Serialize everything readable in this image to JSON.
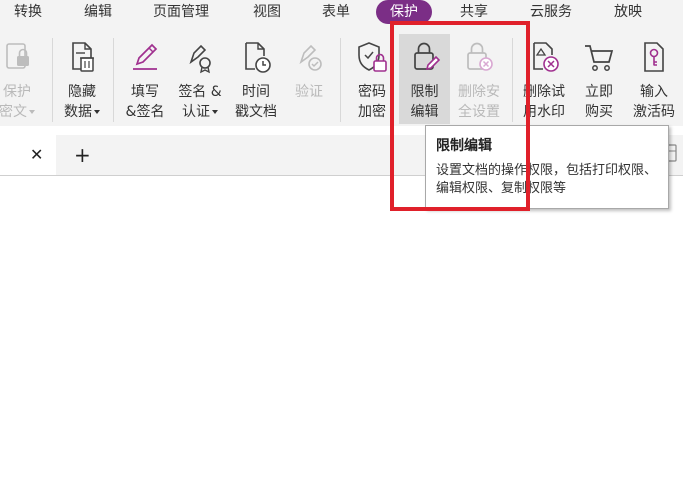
{
  "menu": {
    "tabs": [
      "转换",
      "编辑",
      "页面管理",
      "视图",
      "表单",
      "保护",
      "共享",
      "云服务",
      "放映"
    ],
    "active_index": 5,
    "active_color": "#7b2e86"
  },
  "ribbon": {
    "buttons": [
      {
        "label1": "保护",
        "label2": "密文",
        "dropdown": true,
        "enabled": false,
        "icon": "protect-doc-icon"
      },
      {
        "label1": "隐藏",
        "label2": "数据",
        "dropdown": true,
        "enabled": true,
        "icon": "hide-data-icon"
      },
      {
        "label1": "填写",
        "label2": "&签名",
        "dropdown": false,
        "enabled": true,
        "icon": "pen-sign-icon"
      },
      {
        "label1": "签名 &",
        "label2": "认证",
        "dropdown": true,
        "enabled": true,
        "icon": "sign-certify-icon"
      },
      {
        "label1": "时间",
        "label2": "戳文档",
        "dropdown": false,
        "enabled": true,
        "icon": "timestamp-icon"
      },
      {
        "label1": "验证",
        "label2": "",
        "dropdown": false,
        "enabled": false,
        "icon": "validate-icon"
      },
      {
        "label1": "密码",
        "label2": "加密",
        "dropdown": false,
        "enabled": true,
        "icon": "password-encrypt-icon"
      },
      {
        "label1": "限制",
        "label2": "编辑",
        "dropdown": false,
        "enabled": true,
        "icon": "restrict-edit-icon"
      },
      {
        "label1": "删除安",
        "label2": "全设置",
        "dropdown": false,
        "enabled": false,
        "icon": "remove-security-icon"
      },
      {
        "label1": "删除试",
        "label2": "用水印",
        "dropdown": false,
        "enabled": true,
        "icon": "remove-watermark-icon"
      },
      {
        "label1": "立即",
        "label2": "购买",
        "dropdown": false,
        "enabled": true,
        "icon": "cart-icon"
      },
      {
        "label1": "输入",
        "label2": "激活码",
        "dropdown": false,
        "enabled": true,
        "icon": "activation-key-icon"
      }
    ]
  },
  "tabs": {
    "close_glyph": "✕",
    "add_glyph": "+"
  },
  "tooltip": {
    "title": "限制编辑",
    "description": "设置文档的操作权限，包括打印权限、编辑权限、复制权限等"
  },
  "colors": {
    "highlight": "#e0202a",
    "icon_dark": "#444444",
    "icon_accent": "#a0308f",
    "icon_disabled": "#bdbdbd"
  }
}
